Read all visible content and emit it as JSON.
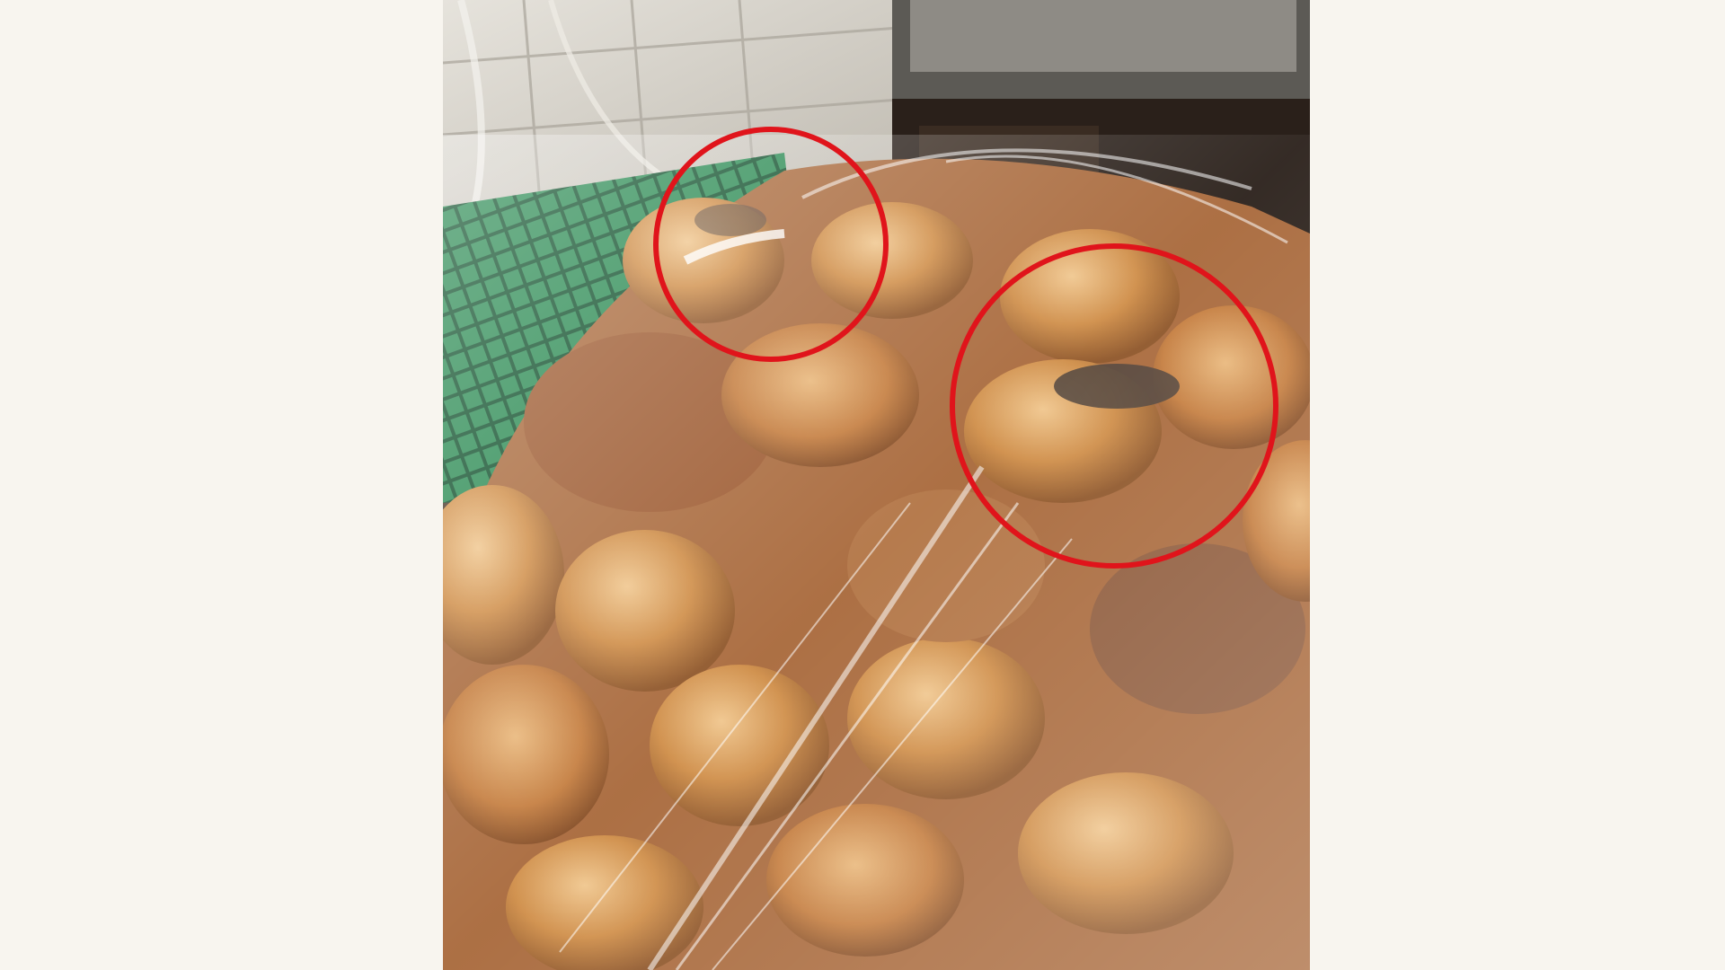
{
  "image": {
    "subject": "bag-of-buns-photo",
    "colors": {
      "page_background": "#f8f5ef",
      "annotation_circle": "#e0141b",
      "crate_green": "#1f7a45",
      "wall": "#d9d6cf",
      "bun": "#c98a4a",
      "bun_highlight": "#e6b47a",
      "plastic_wrap": "#f1e9e2"
    },
    "annotations": [
      {
        "shape": "circle",
        "marks": "top-left-circled-area"
      },
      {
        "shape": "circle",
        "marks": "right-circled-area"
      }
    ]
  }
}
